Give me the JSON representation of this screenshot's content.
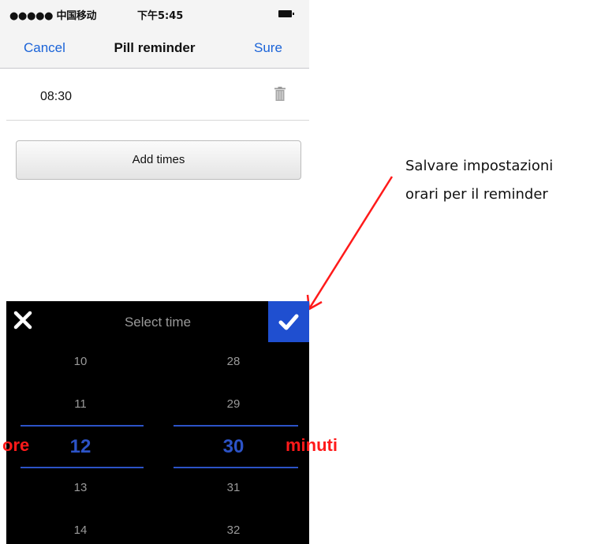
{
  "status_bar": {
    "carrier": "●●●●● 中国移动",
    "time": "下午5:45"
  },
  "nav": {
    "cancel_label": "Cancel",
    "title": "Pill reminder",
    "sure_label": "Sure"
  },
  "reminder_times": [
    {
      "time": "08:30"
    }
  ],
  "add_times_label": "Add times",
  "annotation": {
    "line1": "Salvare impostazioni",
    "line2": "orari per il reminder"
  },
  "picker": {
    "title": "Select time",
    "hours": [
      "10",
      "11",
      "12",
      "13",
      "14"
    ],
    "minutes": [
      "28",
      "29",
      "30",
      "31",
      "32"
    ],
    "label_hours": "ore",
    "label_minutes": "minuti"
  },
  "colors": {
    "accent": "#1a63d8",
    "picker_selection": "#2c53c7",
    "annotation": "#ff1a1a"
  },
  "icons": {
    "trash": "trash-icon",
    "close": "close-icon",
    "confirm": "check-icon"
  }
}
